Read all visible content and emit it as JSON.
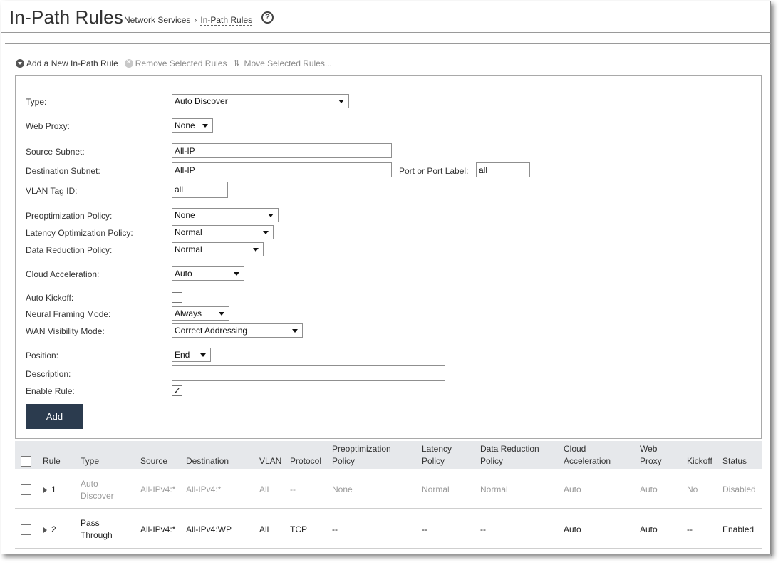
{
  "header": {
    "title": "In-Path Rules",
    "breadcrumb": [
      "Network Services",
      "In-Path Rules"
    ],
    "breadcrumb_separator": "›",
    "help_icon": "question-circle-icon"
  },
  "toolbar": {
    "add_label": "Add a New In-Path Rule",
    "remove_label": "Remove Selected Rules",
    "move_label": "Move Selected Rules..."
  },
  "form": {
    "type_label": "Type:",
    "type_value": "Auto Discover",
    "web_proxy_label": "Web Proxy:",
    "web_proxy_value": "None",
    "source_subnet_label": "Source Subnet:",
    "source_subnet_value": "All-IP",
    "dest_subnet_label": "Destination Subnet:",
    "dest_subnet_value": "All-IP",
    "port_or": "Port or",
    "port_label_link": "Port Label",
    "port_colon": ":",
    "port_value": "all",
    "vlan_label": "VLAN Tag ID:",
    "vlan_value": "all",
    "preopt_label": "Preoptimization Policy:",
    "preopt_value": "None",
    "latency_label": "Latency Optimization Policy:",
    "latency_value": "Normal",
    "data_reduction_label": "Data Reduction Policy:",
    "data_reduction_value": "Normal",
    "cloud_accel_label": "Cloud Acceleration:",
    "cloud_accel_value": "Auto",
    "auto_kickoff_label": "Auto Kickoff:",
    "auto_kickoff_checked": false,
    "neural_label": "Neural Framing Mode:",
    "neural_value": "Always",
    "wan_vis_label": "WAN Visibility Mode:",
    "wan_vis_value": "Correct Addressing",
    "position_label": "Position:",
    "position_value": "End",
    "description_label": "Description:",
    "description_value": "",
    "enable_rule_label": "Enable Rule:",
    "enable_rule_checked": true,
    "check_glyph": "✓",
    "add_button": "Add"
  },
  "table": {
    "headers": {
      "rule": "Rule",
      "type": "Type",
      "source": "Source",
      "destination": "Destination",
      "vlan": "VLAN",
      "protocol": "Protocol",
      "preopt_1": "Preoptimization",
      "preopt_2": "Policy",
      "latency_1": "Latency",
      "latency_2": "Policy",
      "data_red_1": "Data Reduction",
      "data_red_2": "Policy",
      "cloud_1": "Cloud",
      "cloud_2": "Acceleration",
      "web_1": "Web",
      "web_2": "Proxy",
      "kickoff": "Kickoff",
      "status": "Status"
    },
    "rows": [
      {
        "rule": "1",
        "type_1": "Auto",
        "type_2": "Discover",
        "source": "All-IPv4:*",
        "destination": "All-IPv4:*",
        "vlan": "All",
        "protocol": "--",
        "preopt": "None",
        "latency": "Normal",
        "data_reduction": "Normal",
        "cloud": "Auto",
        "web_proxy": "Auto",
        "kickoff": "No",
        "status": "Disabled",
        "enabled": false
      },
      {
        "rule": "2",
        "type_1": "Pass",
        "type_2": "Through",
        "source": "All-IPv4:*",
        "destination": "All-IPv4:WP",
        "vlan": "All",
        "protocol": "TCP",
        "preopt": "--",
        "latency": "--",
        "data_reduction": "--",
        "cloud": "Auto",
        "web_proxy": "Auto",
        "kickoff": "--",
        "status": "Enabled",
        "enabled": true
      }
    ]
  }
}
